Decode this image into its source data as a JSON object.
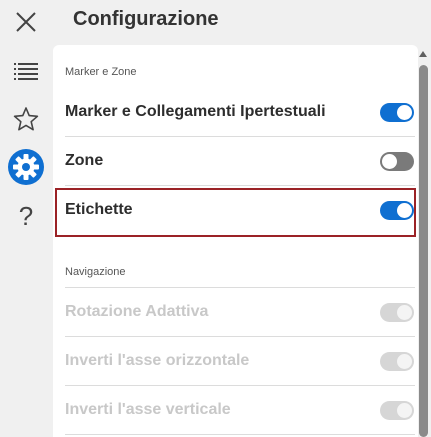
{
  "header": {
    "title": "Configurazione"
  },
  "rail": {
    "items": [
      {
        "icon": "close-icon"
      },
      {
        "icon": "list-icon"
      },
      {
        "icon": "star-icon"
      },
      {
        "icon": "gear-icon",
        "active": true,
        "accent": "#0f6fd1"
      },
      {
        "icon": "help-icon",
        "glyph": "?"
      }
    ]
  },
  "sections": {
    "markers": {
      "label": "Marker e Zone",
      "rows": [
        {
          "label": "Marker e Collegamenti Ipertestuali",
          "state": "on"
        },
        {
          "label": "Zone",
          "state": "off"
        },
        {
          "label": "Etichette",
          "state": "on",
          "highlighted": true
        }
      ]
    },
    "navigation": {
      "label": "Navigazione",
      "rows": [
        {
          "label": "Rotazione Adattiva",
          "state": "disabled"
        },
        {
          "label": "Inverti l'asse orizzontale",
          "state": "disabled"
        },
        {
          "label": "Inverti l'asse verticale",
          "state": "disabled"
        }
      ]
    }
  },
  "colors": {
    "toggle_on": "#0f6fd1",
    "toggle_off": "#7a7a7a",
    "highlight_border": "#9b2226"
  }
}
